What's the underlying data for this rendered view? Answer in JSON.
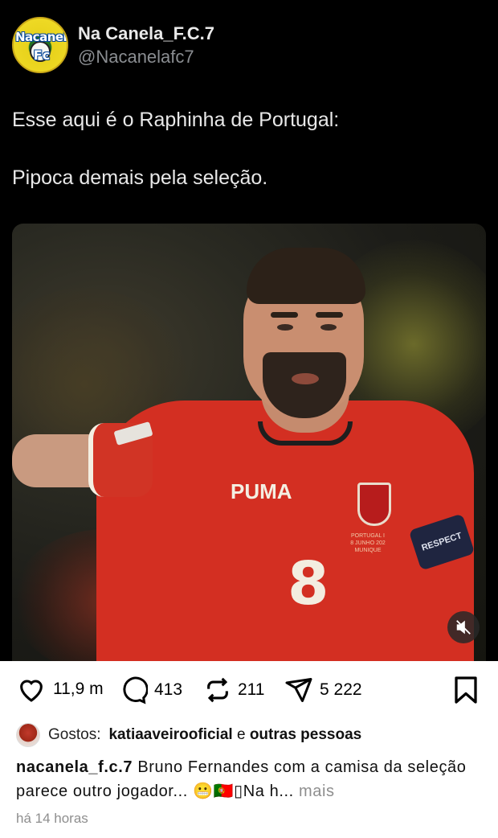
{
  "tweet": {
    "display_name": "Na Canela_F.C.7",
    "handle": "@Nacanelafc7",
    "avatar_text_top": "Nacanela",
    "avatar_text_bottom": "Fc",
    "line1": "Esse aqui é o Raphinha de Portugal:",
    "line2": "Pipoca demais pela seleção.",
    "photo": {
      "brand_mark": "PUMA",
      "shirt_number": "8",
      "armband_text": "RESPECT",
      "match_text": [
        "PORTUGAL I",
        "8 JUNHO 202",
        "MUNIQUE"
      ]
    }
  },
  "actions": {
    "likes_count": "11,9 m",
    "comments_count": "413",
    "reposts_count": "211",
    "shares_count": "5 222"
  },
  "likes_line": {
    "prefix": "Gostos:",
    "user": "katiaaveirooficial",
    "connector": "e",
    "others": "outras pessoas"
  },
  "caption": {
    "username": "nacanela_f.c.7",
    "text": "Bruno Fernandes com a camisa da seleção parece outro jogador... 😬🇵🇹▯Na h...",
    "more": "mais"
  },
  "timestamp": "há 14 horas",
  "icons": [
    "heart-icon",
    "comment-icon",
    "repost-icon",
    "share-icon",
    "bookmark-icon",
    "mute-icon"
  ]
}
